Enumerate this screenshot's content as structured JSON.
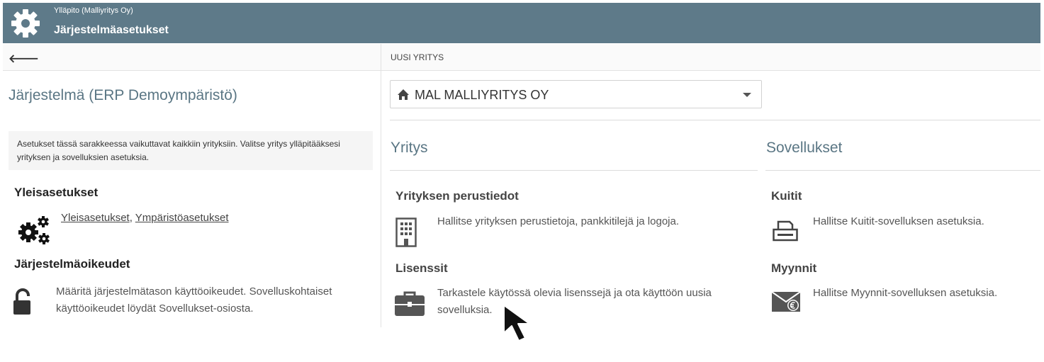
{
  "header": {
    "subtitle": "Ylläpito (Malliyritys Oy)",
    "title": "Järjestelmäasetukset",
    "icon": "gear-icon",
    "background": "#5e7a89"
  },
  "subbar": {
    "back_icon": "arrow-left-icon",
    "back_glyph": "🡐",
    "company_column_label": "UUSI YRITYS"
  },
  "left": {
    "title": "Järjestelmä (ERP Demoympäristö)",
    "info": "Asetukset tässä sarakkeessa vaikuttavat kaikkiin yrityksiin. Valitse yritys ylläpitääksesi yrityksen ja sovelluksien asetuksia.",
    "general": {
      "heading": "Yleisasetukset",
      "link1": "Yleisasetukset",
      "separator": ",",
      "link2": "Ympäristöasetukset"
    },
    "rights": {
      "heading": "Järjestelmäoikeudet",
      "text": "Määritä järjestelmätason käyttöoikeudet. Sovelluskohtaiset käyttöoikeudet löydät Sovellukset-osiosta."
    }
  },
  "right": {
    "company_select": {
      "value": "MAL MALLIYRITYS OY",
      "icon": "home-icon"
    },
    "company": {
      "heading": "Yritys",
      "basic": {
        "title": "Yrityksen perustiedot",
        "text": "Hallitse yrityksen perustietoja, pankkitilejä ja logoja.",
        "icon": "building-icon"
      },
      "licenses": {
        "title": "Lisenssit",
        "text": "Tarkastele käytössä olevia lisenssejä ja ota käyttöön uusia sovelluksia.",
        "icon": "briefcase-icon"
      }
    },
    "apps": {
      "heading": "Sovellukset",
      "receipts": {
        "title": "Kuitit",
        "text": "Hallitse Kuitit-sovelluksen asetuksia.",
        "icon": "receipt-printer-icon"
      },
      "sales": {
        "title": "Myynnit",
        "text": "Hallitse Myynnit-sovelluksen asetuksia.",
        "icon": "euro-envelope-icon"
      }
    }
  },
  "colors": {
    "accent": "#5a7684",
    "header": "#5e7a89"
  }
}
